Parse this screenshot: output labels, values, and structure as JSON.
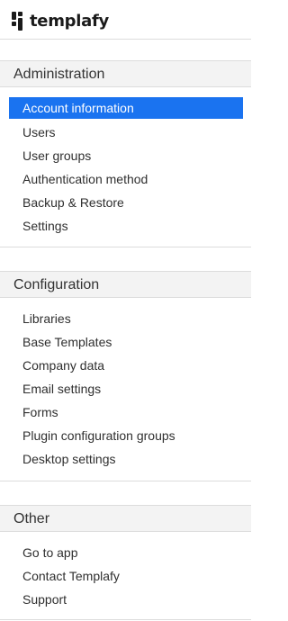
{
  "brand": {
    "name": "templafy"
  },
  "sections": [
    {
      "title": "Administration",
      "items": [
        {
          "label": "Account information",
          "active": true
        },
        {
          "label": "Users",
          "active": false
        },
        {
          "label": "User groups",
          "active": false
        },
        {
          "label": "Authentication method",
          "active": false
        },
        {
          "label": "Backup & Restore",
          "active": false
        },
        {
          "label": "Settings",
          "active": false
        }
      ]
    },
    {
      "title": "Configuration",
      "items": [
        {
          "label": "Libraries",
          "active": false
        },
        {
          "label": "Base Templates",
          "active": false
        },
        {
          "label": "Company data",
          "active": false
        },
        {
          "label": "Email settings",
          "active": false
        },
        {
          "label": "Forms",
          "active": false
        },
        {
          "label": "Plugin configuration groups",
          "active": false
        },
        {
          "label": "Desktop settings",
          "active": false
        }
      ]
    },
    {
      "title": "Other",
      "items": [
        {
          "label": "Go to app",
          "active": false
        },
        {
          "label": "Contact Templafy",
          "active": false
        },
        {
          "label": "Support",
          "active": false
        }
      ]
    }
  ],
  "colors": {
    "accent": "#1a73f0",
    "header_bg": "#f3f3f3",
    "divider": "#dcdcdc"
  }
}
